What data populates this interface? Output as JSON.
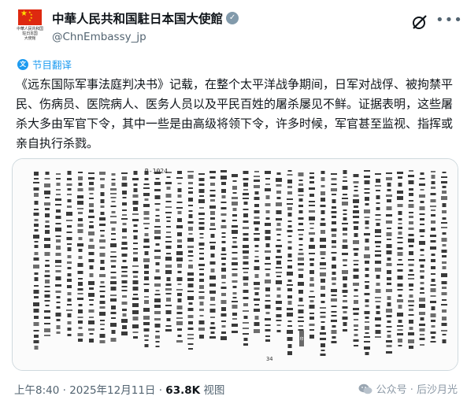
{
  "account": {
    "display_name": "中華人民共和国駐日本国大使館",
    "handle": "@ChnEmbassy_jp",
    "avatar_caption": [
      "中華人民共和国",
      "駐日本国",
      "大使館"
    ],
    "verified_icon": "verified-badge-icon",
    "flag_colors": {
      "red": "#de2910",
      "yellow": "#ffde00"
    }
  },
  "actions": {
    "grok_icon": "grok-icon",
    "more_icon": "more-options-icon"
  },
  "translation": {
    "label": "节目翻译",
    "icon": "translate-icon",
    "accent": "#1d9bf0"
  },
  "tweet": {
    "text": "《远东国际军事法庭判决书》记载，在整个太平洋战争期间，日军对战俘、被拘禁平民、伤病员、医院病人、医务人员以及平民百姓的屠杀屡见不鲜。证据表明，这些屠杀大多由军官下令，其中一些是由高级将领下令，许多时候，军官甚至监视、指挥或亲自执行杀戮。"
  },
  "media": {
    "page_number_top": "R-1024",
    "page_number_bottom": "34",
    "stamp": "印"
  },
  "footer": {
    "time": "上午8:40",
    "separator": " · ",
    "date": "2025年12月11日",
    "views_count": "63.8K",
    "views_label": " 视图"
  },
  "watermark": {
    "text": "公众号 · 后沙月光",
    "icon": "wechat-icon"
  }
}
